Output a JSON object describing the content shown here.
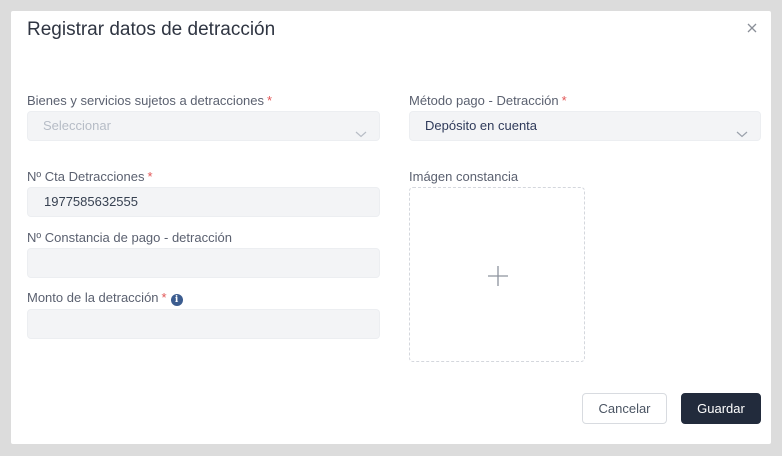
{
  "dialog": {
    "title": "Registrar datos de detracción"
  },
  "form": {
    "bienes": {
      "label": "Bienes y servicios sujetos a detracciones",
      "required_mark": "*",
      "placeholder": "Seleccionar",
      "value": ""
    },
    "metodo_pago": {
      "label": "Método pago - Detracción",
      "required_mark": "*",
      "value": "Depósito en cuenta"
    },
    "cta_detracciones": {
      "label": "Nº Cta Detracciones",
      "required_mark": "*",
      "value": "1977585632555"
    },
    "imagen_constancia": {
      "label": "Imágen constancia"
    },
    "constancia_pago": {
      "label": "Nº Constancia de pago - detracción",
      "value": ""
    },
    "monto": {
      "label": "Monto de la detracción",
      "required_mark": "*",
      "info_icon_glyph": "i",
      "value": ""
    }
  },
  "buttons": {
    "cancel_label": "Cancelar",
    "save_label": "Guardar"
  },
  "icons": {
    "close": "close-icon",
    "chevron": "chevron-down-icon",
    "plus": "plus-icon",
    "info": "info-icon"
  },
  "colors": {
    "required": "#e25656",
    "primary_button": "#222b3c",
    "field_background": "#f3f4f6",
    "info_icon": "#3b5c8f"
  }
}
